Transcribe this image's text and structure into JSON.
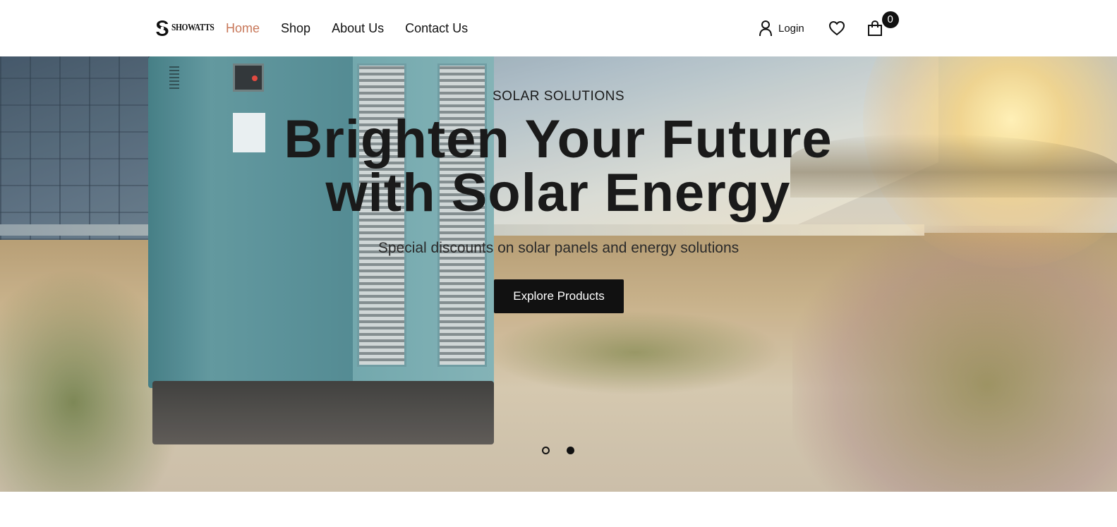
{
  "header": {
    "logo_text": "SHOWATTS",
    "nav": [
      {
        "label": "Home",
        "active": true
      },
      {
        "label": "Shop",
        "active": false
      },
      {
        "label": "About Us",
        "active": false
      },
      {
        "label": "Contact Us",
        "active": false
      }
    ],
    "login_label": "Login",
    "cart_count": "0",
    "icons": {
      "user": "user-icon",
      "wishlist": "heart-icon",
      "cart": "shopping-bag-icon"
    },
    "active_color": "#c8785a"
  },
  "hero": {
    "eyebrow": "SOLAR SOLUTIONS",
    "headline_line1": "Brighten Your Future",
    "headline_line2": "with Solar Energy",
    "subline": "Special discounts on solar panels and energy solutions",
    "cta_label": "Explore Products",
    "slides": {
      "count": 2,
      "active_index": 1
    }
  }
}
